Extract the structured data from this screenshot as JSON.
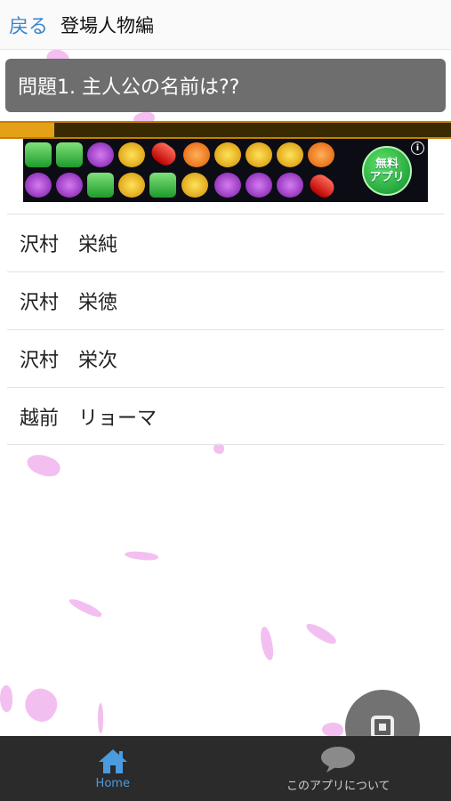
{
  "header": {
    "back_label": "戻る",
    "title": "登場人物編"
  },
  "question": {
    "text": "問題1. 主人公の名前は??"
  },
  "progress": {
    "fraction": 0.12
  },
  "ad": {
    "free_line1": "無料",
    "free_line2": "アプリ",
    "info_icon": "info-icon"
  },
  "answers": [
    {
      "label": "沢村　栄純"
    },
    {
      "label": "沢村　栄徳"
    },
    {
      "label": "沢村　栄次"
    },
    {
      "label": "越前　リョーマ"
    }
  ],
  "bottom_nav": {
    "home_label": "Home",
    "about_label": "このアプリについて",
    "home_icon": "home-icon",
    "about_icon": "chat-bubble-icon",
    "active_color": "#4a9be0"
  },
  "float_button": {
    "icon": "stop-square-icon"
  }
}
